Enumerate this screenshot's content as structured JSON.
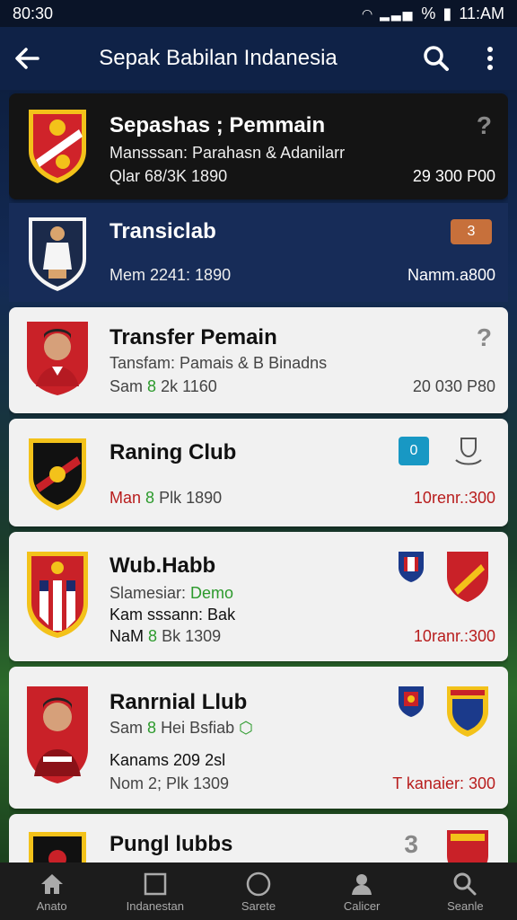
{
  "status_bar": {
    "time_left": "80:30",
    "battery_text": "%",
    "time_right": "11:AM"
  },
  "app_bar": {
    "title": "Sepak Babilan Indanesia"
  },
  "colors": {
    "app_bar": "#0f2247",
    "accent_red": "#b81d1d",
    "accent_green": "#2c9a2c",
    "badge_orange": "#c7703b",
    "badge_cyan": "#1898c4"
  },
  "cards": [
    {
      "title": "Sepashas ; Pemmain",
      "line1": "Mansssan: Parahasn & Adanilarr",
      "line2": "Qlar 68/3K 1890",
      "right": "29 300 P00",
      "corner": "?"
    },
    {
      "title": "Transiclab",
      "line2": "Mem 2241: 1890",
      "right": "Namm.a800",
      "badge": "3"
    },
    {
      "title": "Transfer Pemain",
      "line1": "Tansfam: Pamais & B Binadns",
      "line2_a": "Sam",
      "line2_b": "8",
      "line2_c": "2k 1160",
      "right": "20 030 P80",
      "corner": "?"
    },
    {
      "title": "Raning Club",
      "line2_a": "Man",
      "line2_b": "8",
      "line2_c": "Plk 1890",
      "right": "10renr.:300",
      "badge": "0"
    },
    {
      "title": "Wub.Habb",
      "line1_a": "Slamesiar:",
      "line1_b": "Demo",
      "line1b": "Kam sssann: Bak",
      "line2_a": "NaM",
      "line2_b": "8",
      "line2_c": "Bk 1309",
      "right": "10ranr.:300"
    },
    {
      "title": "Ranrnial Llub",
      "line1_a": "Sam",
      "line1_b": "8",
      "line1_c": "Hei Bsfiab",
      "line1b": "Kanams 209 2sl",
      "line2": "Nom 2; Plk 1309",
      "right": "T kanaier: 300"
    },
    {
      "title": "Pungl lubbs",
      "corner": "3"
    }
  ],
  "bottom_nav": [
    {
      "label": "Anato",
      "icon": "home-icon"
    },
    {
      "label": "Indanestan",
      "icon": "square-icon"
    },
    {
      "label": "Sarete",
      "icon": "circle-icon"
    },
    {
      "label": "Calicer",
      "icon": "person-icon"
    },
    {
      "label": "Seanle",
      "icon": "search-icon"
    }
  ]
}
